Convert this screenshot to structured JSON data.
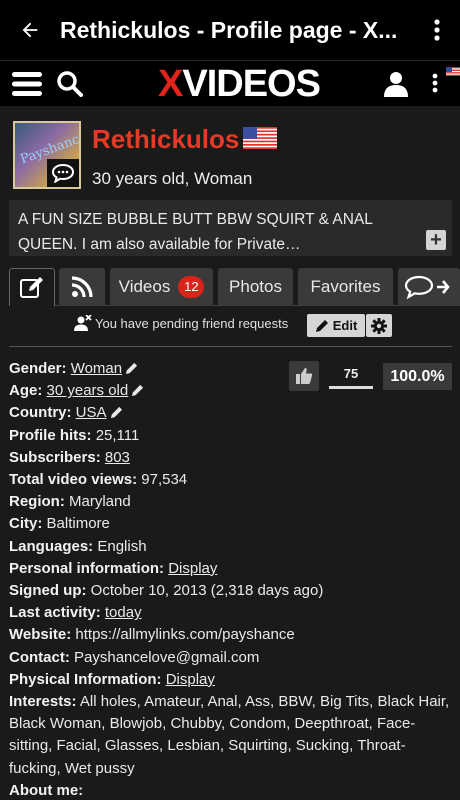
{
  "appbar": {
    "title": "Rethickulos - Profile page - X...",
    "back_icon": "arrow-left-icon",
    "menu_icon": "more-vert-icon"
  },
  "site": {
    "logo_x": "X",
    "logo_rest": "VIDEOS",
    "brand_color": "#e0241b"
  },
  "profile": {
    "name": "Rethickulos",
    "info": "30 years old, Woman",
    "avatar_text": "Payshance",
    "bio": "A FUN SIZE BUBBLE BUTT BBW SQUIRT & ANAL QUEEN. I am also available for Private…",
    "bio_more": "+"
  },
  "tabs": [
    {
      "label": ""
    },
    {
      "label": ""
    },
    {
      "label": "Videos",
      "badge": "12"
    },
    {
      "label": "Photos"
    },
    {
      "label": "Favorites"
    },
    {
      "label": ""
    }
  ],
  "friend_requests": "You have pending friend requests",
  "edit_label": "Edit",
  "votes": {
    "count": "75",
    "percent": "100.0%",
    "ratio": 1.0
  },
  "details": {
    "gender_label": "Gender:",
    "gender": "Woman",
    "age_label": "Age:",
    "age": "30 years old",
    "country_label": "Country:",
    "country": "USA",
    "hits_label": "Profile hits:",
    "hits": "25,111",
    "subs_label": "Subscribers:",
    "subs": "803",
    "views_label": "Total video views:",
    "views": "97,534",
    "region_label": "Region:",
    "region": "Maryland",
    "city_label": "City:",
    "city": "Baltimore",
    "lang_label": "Languages:",
    "lang": "English",
    "personal_label": "Personal information:",
    "personal": "Display",
    "signed_label": "Signed up:",
    "signed": "October 10, 2013 (2,318 days ago)",
    "last_label": "Last activity:",
    "last": "today",
    "website_label": "Website:",
    "website": "https://allmylinks.com/payshance",
    "contact_label": "Contact:",
    "contact": "Payshancelove@gmail.com",
    "physical_label": "Physical Information:",
    "physical": "Display",
    "interests_label": "Interests:",
    "interests": "All holes, Amateur, Anal, Ass, BBW, Big Tits, Black Hair, Black Woman, Blowjob, Chubby, Condom, Deepthroat, Face-sitting, Facial, Glasses, Lesbian, Squirting, Sucking, Throat-fucking, Wet pussy",
    "about_label": "About me:"
  }
}
